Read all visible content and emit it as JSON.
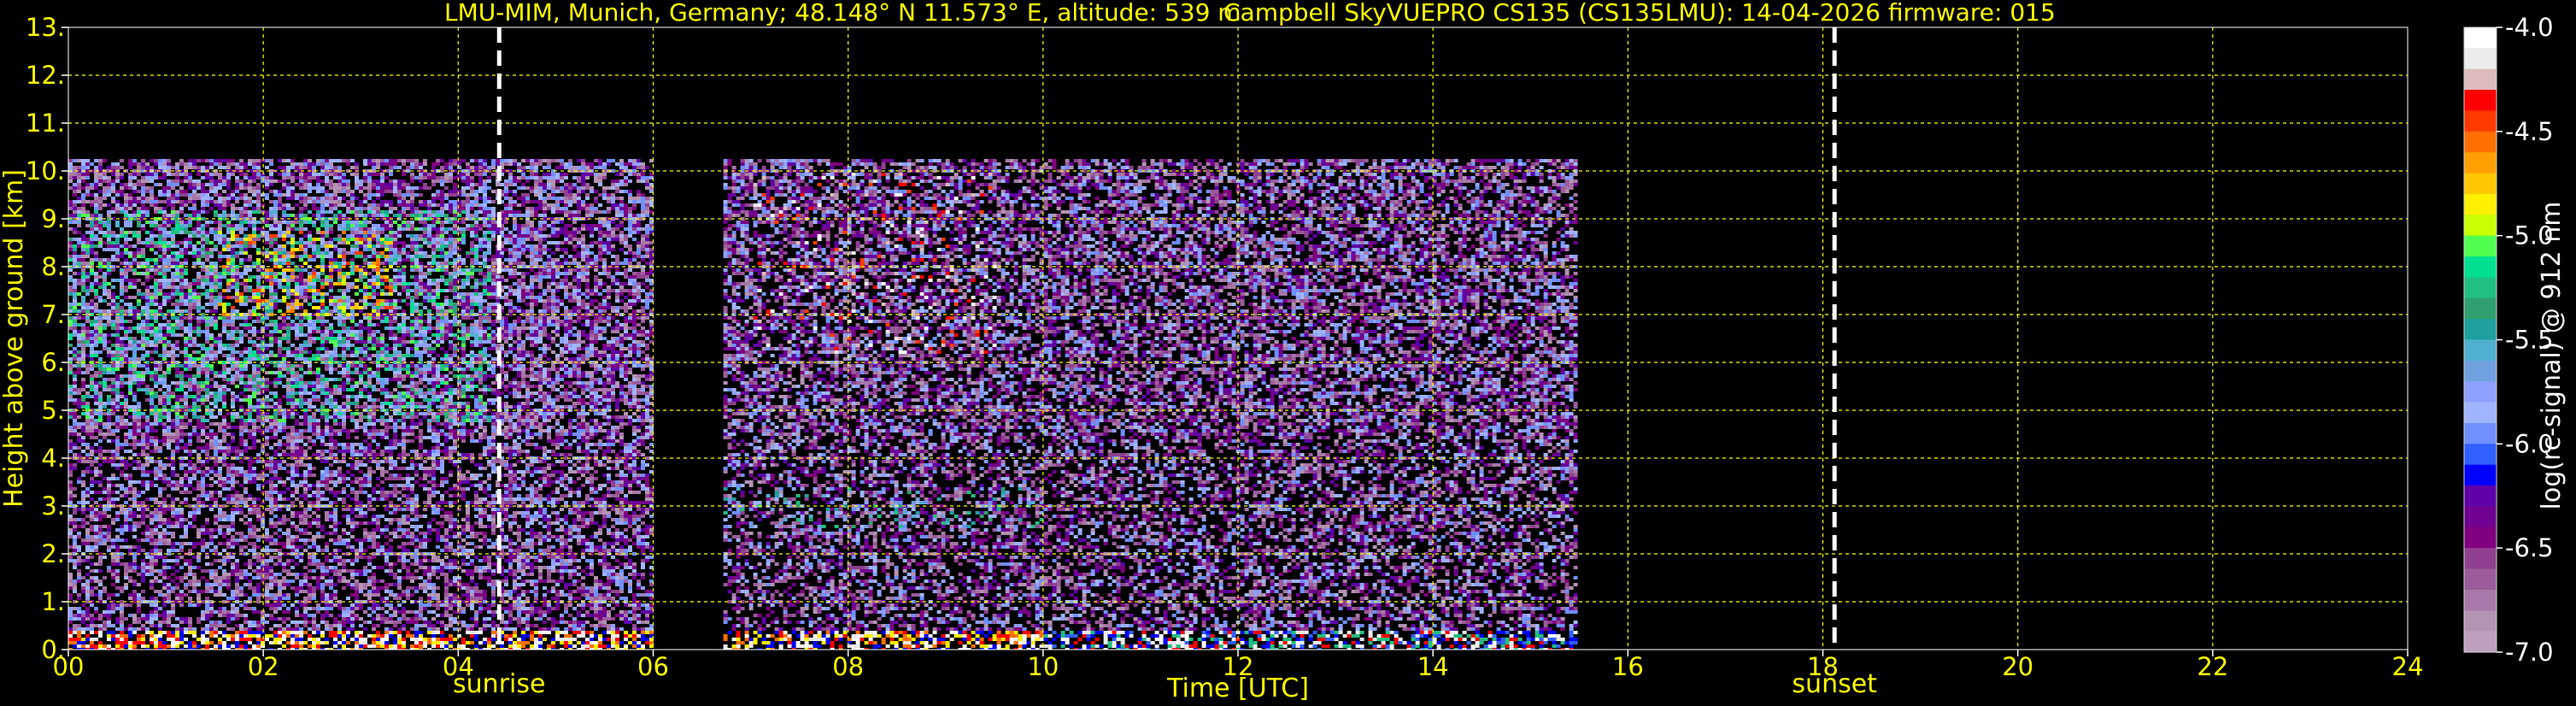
{
  "chart_data": {
    "type": "heatmap",
    "title_left": "LMU-MIM, Munich, Germany; 48.148° N 11.573° E, altitude: 539 m",
    "title_right": "Campbell SkyVUEPRO CS135 (CS135LMU): 14-04-2026    firmware: 015",
    "xlabel": "Time [UTC]",
    "ylabel": "Height above ground [km]",
    "xlim": [
      0,
      24
    ],
    "ylim": [
      0,
      13
    ],
    "xticks": [
      "00",
      "02",
      "04",
      "06",
      "08",
      "10",
      "12",
      "14",
      "16",
      "18",
      "20",
      "22",
      "24"
    ],
    "yticks": [
      "0.",
      "1.",
      "2.",
      "3.",
      "4.",
      "5.",
      "6.",
      "7.",
      "8.",
      "9.",
      "10.",
      "11.",
      "12.",
      "13."
    ],
    "grid": true,
    "grid_color": "#ffff00",
    "vlines": [
      {
        "label": "sunrise",
        "x": 4.42
      },
      {
        "label": "sunset",
        "x": 18.12
      }
    ],
    "data_segments": [
      {
        "x_start": 0.0,
        "x_end": 6.0,
        "top_km": 10.25
      },
      {
        "x_start": 6.72,
        "x_end": 15.45,
        "top_km": 10.25
      }
    ],
    "data_gap": [
      6.0,
      6.72
    ],
    "colorbar": {
      "label": "log(rc-signal) @ 912 nm",
      "min": -7.0,
      "max": -4.0,
      "ticks": [
        "-4.0",
        "-4.5",
        "-5.0",
        "-5.5",
        "-6.0",
        "-6.5",
        "-7.0"
      ],
      "colors": [
        "#ffffff",
        "#ececec",
        "#dcbcbc",
        "#ff0000",
        "#ff3a00",
        "#ff7000",
        "#ffa000",
        "#ffc800",
        "#fff000",
        "#c8ff00",
        "#50ff50",
        "#00e090",
        "#20c080",
        "#30a070",
        "#20a0a0",
        "#50b0d0",
        "#70a0e0",
        "#8fa0ff",
        "#a0b4ff",
        "#7090ff",
        "#3060ff",
        "#0000ff",
        "#6000a8",
        "#700090",
        "#800080",
        "#904090",
        "#9c5c9c",
        "#a878a8",
        "#b494b4",
        "#bea0be"
      ]
    }
  }
}
